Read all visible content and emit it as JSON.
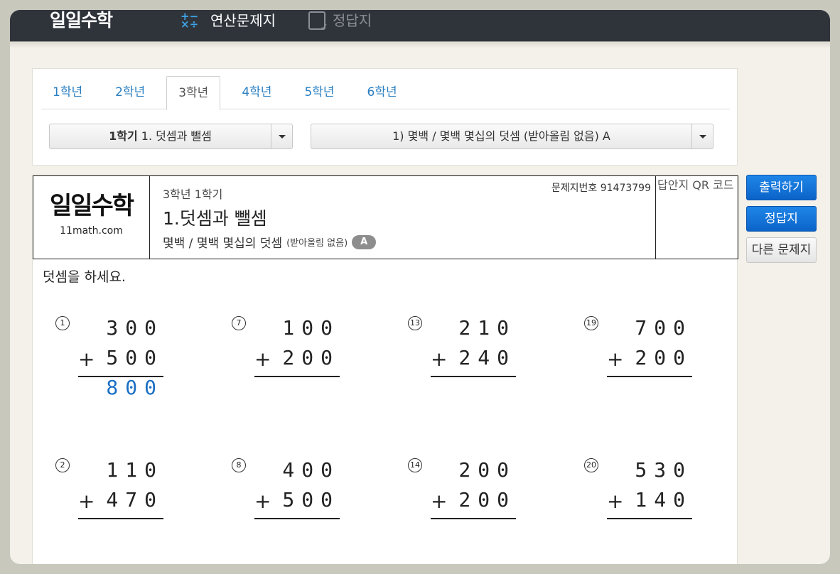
{
  "topbar": {
    "logo": "일일수학",
    "nav_calc": "연산문제지",
    "nav_answer": "정답지"
  },
  "tabs": [
    "1학년",
    "2학년",
    "3학년",
    "4학년",
    "5학년",
    "6학년"
  ],
  "active_tab": "3학년",
  "select_unit": {
    "bold": "1학기",
    "text": " 1. 덧셈과 뺄셈"
  },
  "select_type": "1) 몇백 / 몇백 몇십의 덧셈 (받아올림 없음) A",
  "sheet": {
    "logo": "일일수학",
    "url": "11math.com",
    "grade": "3학년 1학기",
    "chapter": "1.덧셈과 뺄셈",
    "subtitle": "몇백 / 몇백 몇십의 덧셈",
    "subtitle_note": "(받아올림 없음)",
    "badge": "A",
    "sheet_no": "문제지번호 91473799",
    "qr_alt": "답안지 QR 코드",
    "instruction": "덧셈을 하세요."
  },
  "problems": [
    {
      "n": "1",
      "a": "300",
      "b": "500",
      "ans": "800"
    },
    {
      "n": "7",
      "a": "100",
      "b": "200",
      "ans": ""
    },
    {
      "n": "13",
      "a": "210",
      "b": "240",
      "ans": ""
    },
    {
      "n": "19",
      "a": "700",
      "b": "200",
      "ans": ""
    },
    {
      "n": "2",
      "a": "110",
      "b": "470",
      "ans": ""
    },
    {
      "n": "8",
      "a": "400",
      "b": "500",
      "ans": ""
    },
    {
      "n": "14",
      "a": "200",
      "b": "200",
      "ans": ""
    },
    {
      "n": "20",
      "a": "530",
      "b": "140",
      "ans": ""
    }
  ],
  "buttons": {
    "print": "출력하기",
    "answer": "정답지",
    "other": "다른 문제지"
  },
  "colors": {
    "accent_blue": "#0b63c8",
    "answer_blue": "#1a6fc4",
    "topbar": "#2f343b"
  }
}
